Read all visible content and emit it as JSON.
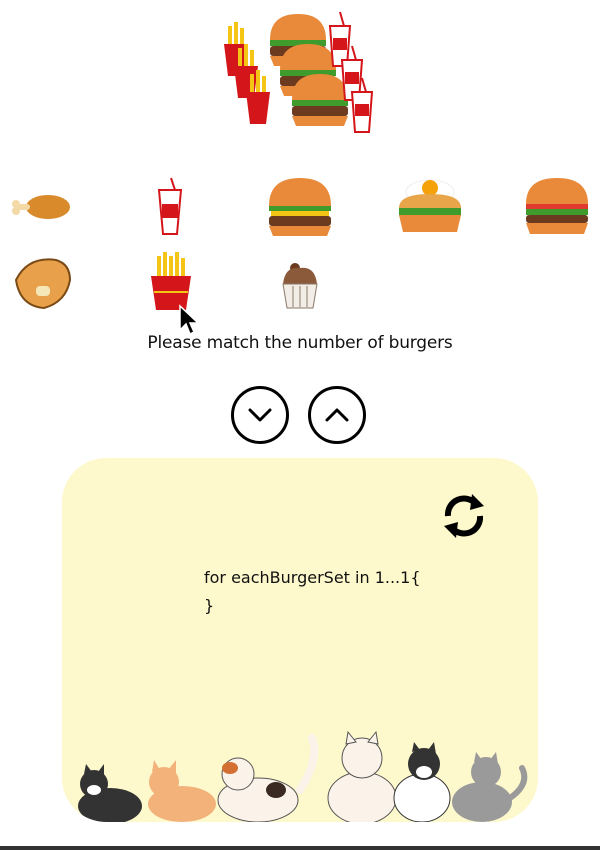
{
  "prompt": "Please match the number of burgers",
  "code": {
    "line1": "for eachBurgerSet in 1...1{",
    "line2": "}"
  },
  "target_set": {
    "items": [
      "fries-icon",
      "burger-icon",
      "soda-icon"
    ],
    "burger_count": 3
  },
  "palette": [
    {
      "name": "chicken-leg-icon"
    },
    {
      "name": "soda-cup-icon"
    },
    {
      "name": "cheeseburger-icon"
    },
    {
      "name": "egg-burger-icon"
    },
    {
      "name": "veggie-burger-icon"
    },
    {
      "name": "chicken-wing-icon"
    },
    {
      "name": "fries-icon"
    },
    {
      "name": "cupcake-icon"
    }
  ],
  "controls": {
    "down": "chevron-down-icon",
    "up": "chevron-up-icon",
    "refresh": "refresh-icon"
  },
  "colors": {
    "panel_bg": "#fdf9cc",
    "bun": "#e98a3a",
    "patty": "#6b3a1f",
    "fries_box": "#d4161b",
    "fries": "#f5c516"
  }
}
